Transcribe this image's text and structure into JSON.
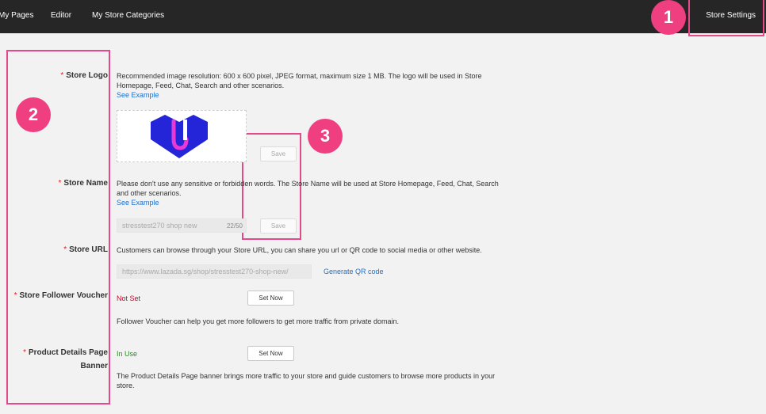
{
  "nav": {
    "items": [
      "My Pages",
      "Editor",
      "My Store Categories"
    ],
    "settings": "Store Settings"
  },
  "markers": [
    "1",
    "2",
    "3"
  ],
  "logo": {
    "label": "Store Logo",
    "description": "Recommended image resolution: 600 x 600 pixel, JPEG format, maximum size 1 MB. The logo will be used in Store Homepage, Feed, Chat, Search and other scenarios.",
    "see_example": "See Example",
    "save": "Save"
  },
  "name": {
    "label": "Store Name",
    "description": "Please don't use any sensitive or forbidden words. The Store Name will be used at Store Homepage, Feed, Chat, Search and other scenarios.",
    "see_example": "See Example",
    "value": "stresstest270 shop new",
    "counter": "22/50",
    "save": "Save"
  },
  "url": {
    "label": "Store URL",
    "description": "Customers can browse through your Store URL, you can share you url or QR code to social media or other website.",
    "value": "https://www.lazada.sg/shop/stresstest270-shop-new/",
    "qr_link": "Generate QR code"
  },
  "voucher": {
    "label": "Store Follower Voucher",
    "status": "Not Set",
    "button": "Set Now",
    "description": "Follower Voucher can help you get more followers to get more traffic from private domain."
  },
  "banner": {
    "label_line1": "Product Details Page",
    "label_line2": "Banner",
    "status": "In Use",
    "button": "Set Now",
    "description": "The Product Details Page banner brings more traffic to your store and guide customers to browse more products in your store."
  },
  "colors": {
    "accent": "#e6498a",
    "link": "#1a70d2",
    "topbar": "#262626"
  }
}
